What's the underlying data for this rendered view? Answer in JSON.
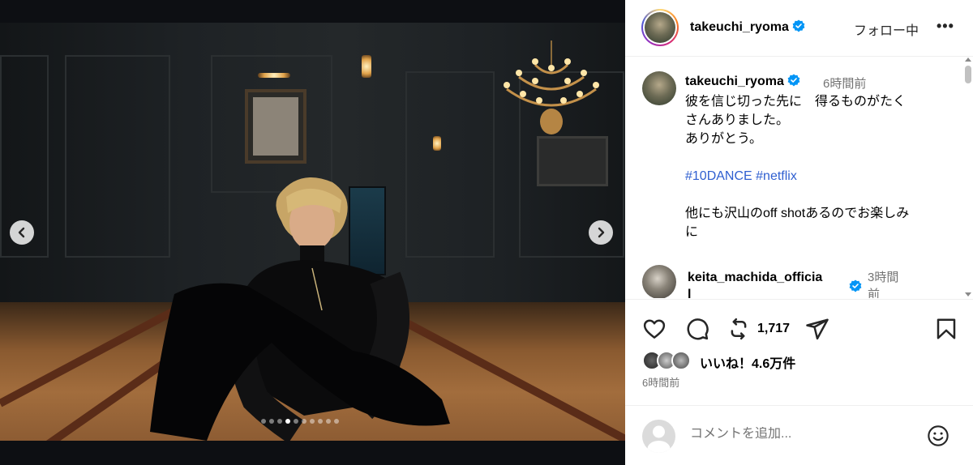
{
  "header": {
    "username": "takeuchi_ryoma",
    "follow_label": "フォロー中",
    "more_label": "•••"
  },
  "caption": {
    "username": "takeuchi_ryoma",
    "time": "6時間前",
    "text": "彼を信じ切った先に　得るものがたく\nさんありました。\nありがとう。",
    "hashtag_1": "#10DANCE",
    "hashtag_2": "#netflix",
    "text_2": "他にも沢山のoff shotあるのでお楽しみ\nに"
  },
  "comment": {
    "username": "keita_machida_officia\nl",
    "time": "3時間\n前"
  },
  "actions": {
    "repost_count": "1,717",
    "likes": "いいね！4.6万件",
    "post_time": "6時間前"
  },
  "add_comment": {
    "placeholder": "コメントを追加..."
  },
  "carousel": {
    "slide_count": 10,
    "active_index": 3
  },
  "colors": {
    "verified": "#0095f6",
    "hashtag": "#2f5fd0",
    "secondary_text": "#737373"
  },
  "icons": [
    "chevron-left-icon",
    "chevron-right-icon",
    "verified-badge-icon",
    "heart-icon",
    "comment-icon",
    "repost-icon",
    "share-icon",
    "bookmark-icon",
    "emoji-icon"
  ]
}
